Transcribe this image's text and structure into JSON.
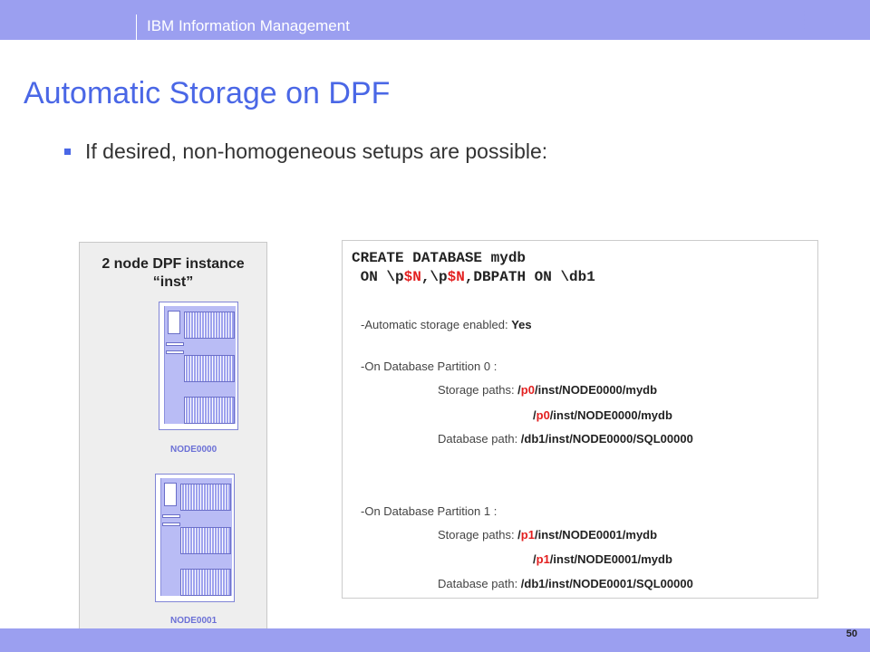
{
  "header": {
    "title": "IBM Information Management",
    "logo": "IBM",
    "bar_color": "#9b9ff0"
  },
  "slide": {
    "title": "Automatic Storage on DPF",
    "bullet": "If desired, non-homogeneous setups are possible:",
    "page_number": "50"
  },
  "dpf_panel": {
    "title_line1": "2 node DPF instance",
    "title_line2": "“inst”",
    "nodes": [
      "NODE0000",
      "NODE0001"
    ]
  },
  "code": {
    "line1": "CREATE DATABASE mydb",
    "line2_part1": " ON \\p",
    "line2_var1": "$N",
    "line2_part2": ",\\p",
    "line2_var2": "$N",
    "line2_part3": ",DBPATH ON \\db1"
  },
  "output": {
    "auto_storage_label": "-Automatic storage enabled: ",
    "auto_storage_value": "Yes",
    "partitions": [
      {
        "heading": "-On Database Partition 0 :",
        "storage_label": "Storage paths: ",
        "paths": [
          {
            "pre": "/",
            "hl": "p0",
            "post": "/inst/NODE0000/mydb"
          },
          {
            "pre": "/",
            "hl": "p0",
            "post": "/inst/NODE0000/mydb"
          }
        ],
        "dbpath_label": "Database path: ",
        "dbpath": "/db1/inst/NODE0000/SQL00000"
      },
      {
        "heading": "-On Database Partition 1 :",
        "storage_label": "Storage paths: ",
        "paths": [
          {
            "pre": "/",
            "hl": "p1",
            "post": "/inst/NODE0001/mydb"
          },
          {
            "pre": "/",
            "hl": "p1",
            "post": "/inst/NODE0001/mydb"
          }
        ],
        "dbpath_label": "Database path: ",
        "dbpath": "/db1/inst/NODE0001/SQL00000"
      }
    ]
  },
  "colors": {
    "accent": "#4a67e6",
    "highlight": "#e32020",
    "node_label": "#6b70d6"
  }
}
